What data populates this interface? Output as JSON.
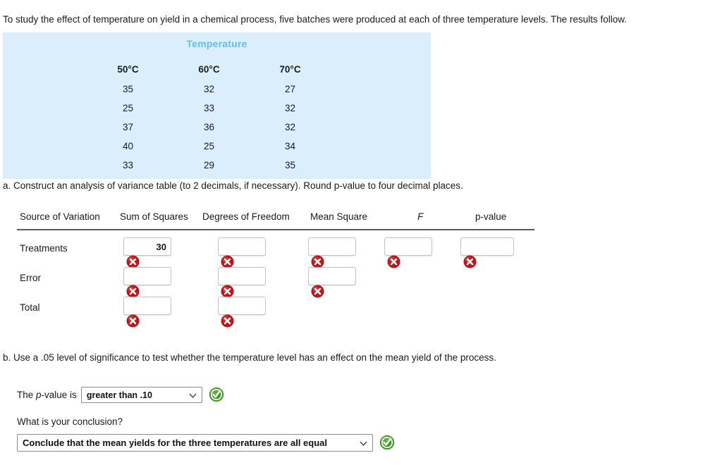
{
  "intro": "To study the effect of temperature on yield in a chemical process, five batches were produced at each of three temperature levels. The results follow.",
  "data_table": {
    "title": "Temperature",
    "headers": [
      "50°C",
      "60°C",
      "70°C"
    ],
    "rows": [
      [
        "35",
        "32",
        "27"
      ],
      [
        "25",
        "33",
        "32"
      ],
      [
        "37",
        "36",
        "32"
      ],
      [
        "40",
        "25",
        "34"
      ],
      [
        "33",
        "29",
        "35"
      ]
    ],
    "background_color": "#daeefc",
    "title_color": "#5ec0f0"
  },
  "part_a": {
    "prompt": "a. Construct an analysis of variance table (to 2 decimals, if necessary). Round p-value to four decimal places.",
    "headers": {
      "source": "Source of Variation",
      "ss": "Sum of Squares",
      "df": "Degrees of Freedom",
      "ms": "Mean Square",
      "f": "F",
      "p": "p-value"
    },
    "rows": [
      {
        "label": "Treatments",
        "cells": [
          {
            "value": "30",
            "status": "incorrect"
          },
          {
            "value": "",
            "status": "incorrect"
          },
          {
            "value": "",
            "status": "incorrect"
          },
          {
            "value": "",
            "status": "incorrect"
          },
          {
            "value": "",
            "status": "incorrect"
          }
        ]
      },
      {
        "label": "Error",
        "cells": [
          {
            "value": "",
            "status": "incorrect"
          },
          {
            "value": "",
            "status": "incorrect"
          },
          {
            "value": "",
            "status": "incorrect"
          }
        ]
      },
      {
        "label": "Total",
        "cells": [
          {
            "value": "",
            "status": "incorrect"
          },
          {
            "value": "",
            "status": "incorrect"
          }
        ]
      }
    ]
  },
  "part_b": {
    "prompt": "b. Use a .05 level of significance to test whether the temperature level has an effect on the mean yield of the process.",
    "pvalue_label_pre": "The ",
    "pvalue_label_italic": "p",
    "pvalue_label_post": "-value is",
    "pvalue_selected": "greater than .10",
    "pvalue_status": "correct",
    "conclusion_prompt": "What is your conclusion?",
    "conclusion_selected": "Conclude that the mean yields for the three temperatures are all equal",
    "conclusion_status": "correct"
  },
  "colors": {
    "incorrect": "#c0131a",
    "correct": "#3f9a26",
    "rule": "#595959"
  }
}
